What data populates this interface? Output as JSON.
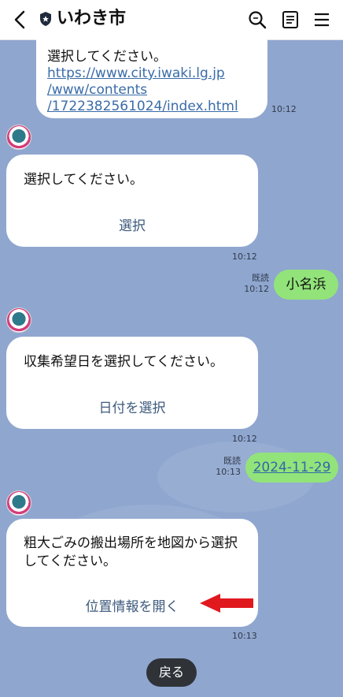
{
  "header": {
    "title": "いわき市",
    "icons": [
      "back-arrow-icon",
      "shield-icon",
      "search-icon",
      "notes-icon",
      "menu-icon"
    ]
  },
  "messages": {
    "m1": {
      "text": "選択してください。",
      "link1": "https://www.city.iwaki.lg.jp",
      "link2": "/www/contents",
      "link3": "/1722382561024/index.html",
      "time": "10:12"
    },
    "m2": {
      "text": "選択してください。",
      "action": "選択",
      "time": "10:12"
    },
    "u1": {
      "text": "小名浜",
      "read": "既読",
      "time": "10:12"
    },
    "m3": {
      "text": "収集希望日を選択してください。",
      "action": "日付を選択",
      "time": "10:12"
    },
    "u2": {
      "text": "2024-11-29",
      "read": "既読",
      "time": "10:13"
    },
    "m4": {
      "text1": "粗大ごみの搬出場所を地図から選択",
      "text2": "してください。",
      "action": "位置情報を開く",
      "time": "10:13"
    }
  },
  "footer": {
    "back_label": "戻る"
  },
  "colors": {
    "background": "#8fa6cf",
    "user_bubble": "#92e37a",
    "annotation_arrow": "#e0191f"
  }
}
